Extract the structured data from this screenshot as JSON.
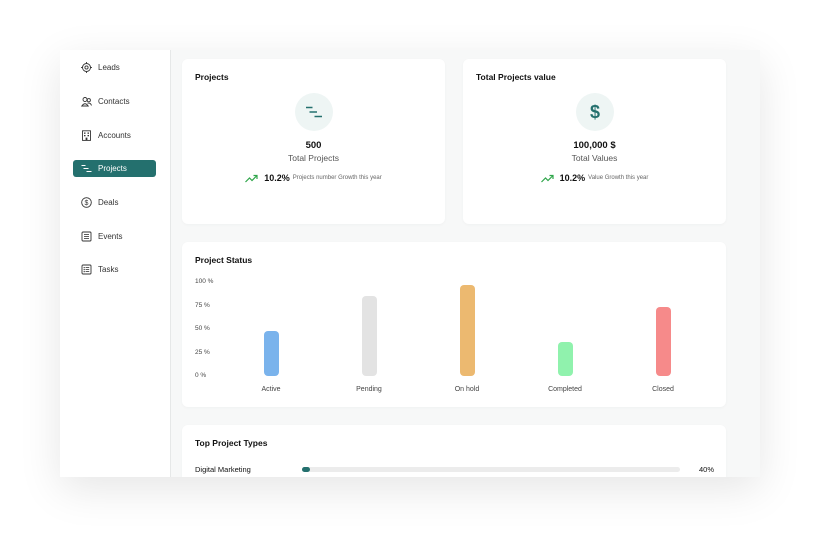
{
  "sidebar": {
    "items": [
      {
        "label": "Leads",
        "icon": "target-icon",
        "active": false
      },
      {
        "label": "Contacts",
        "icon": "contacts-icon",
        "active": false
      },
      {
        "label": "Accounts",
        "icon": "building-icon",
        "active": false
      },
      {
        "label": "Projects",
        "icon": "projects-icon",
        "active": true
      },
      {
        "label": "Deals",
        "icon": "dollar-circle-icon",
        "active": false
      },
      {
        "label": "Events",
        "icon": "calendar-list-icon",
        "active": false
      },
      {
        "label": "Tasks",
        "icon": "task-list-icon",
        "active": false
      }
    ]
  },
  "projects_card": {
    "title": "Projects",
    "value": "500",
    "label": "Total Projects",
    "growth_pct": "10.2%",
    "growth_desc": "Projects number Growth this year"
  },
  "value_card": {
    "title": "Total Projects value",
    "icon_symbol": "$",
    "value": "100,000 $",
    "label": "Total Values",
    "growth_pct": "10.2%",
    "growth_desc": "Value Growth this year"
  },
  "colors": {
    "accent": "#24706e",
    "growth": "#2fa64a"
  },
  "project_status": {
    "title": "Project Status",
    "chart_data": {
      "type": "bar",
      "categories": [
        "Active",
        "Pending",
        "On hold",
        "Completed",
        "Closed"
      ],
      "values": [
        48,
        85,
        97,
        36,
        73
      ],
      "colors": [
        "#7ab3ec",
        "#e3e3e3",
        "#ecb970",
        "#90f2ad",
        "#f68a8a"
      ],
      "ylim": [
        0,
        100
      ],
      "yticks": [
        "100 %",
        "75 %",
        "50 %",
        "25 %",
        "0 %"
      ],
      "grid": false
    }
  },
  "top_types": {
    "title": "Top Project Types",
    "items": [
      {
        "label": "Digital Marketing",
        "percent": "40%",
        "fill": 0.02
      }
    ]
  }
}
